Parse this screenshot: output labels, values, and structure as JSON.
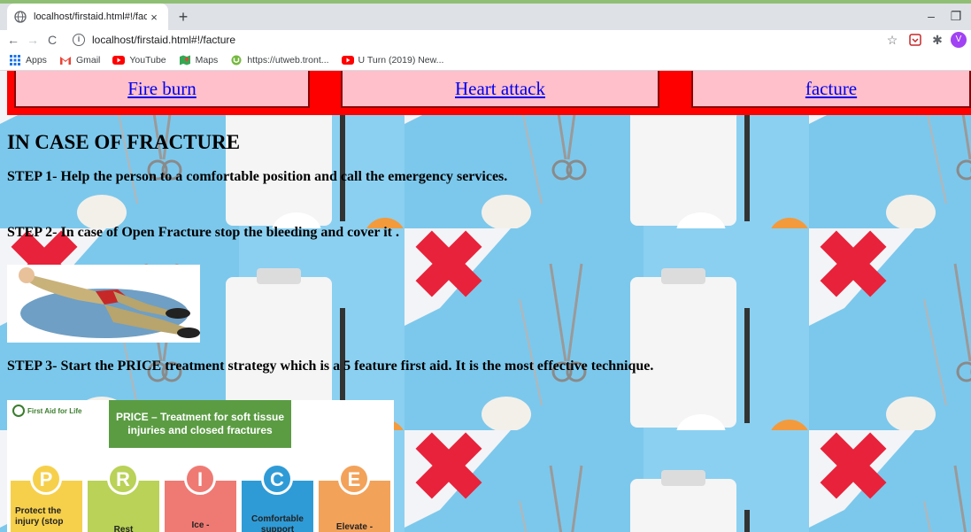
{
  "browser": {
    "tab_title": "localhost/firstaid.html#!/facture",
    "tab_close": "×",
    "new_tab": "+",
    "url": "localhost/firstaid.html#!/facture",
    "info_icon": "i",
    "minimize": "–",
    "restore": "❐",
    "star_icon": "☆",
    "extensions_icon": "✱",
    "profile_initial": "V",
    "nav": {
      "back": "←",
      "forward": "→",
      "reload": "C"
    }
  },
  "bookmarks": [
    {
      "label": "Apps",
      "icon": "apps-grid-icon",
      "color": "#1a73e8"
    },
    {
      "label": "Gmail",
      "icon": "gmail-icon",
      "color": "#ea4335"
    },
    {
      "label": "YouTube",
      "icon": "youtube-icon",
      "color": "#ff0000"
    },
    {
      "label": "Maps",
      "icon": "maps-icon",
      "color": "#34a853"
    },
    {
      "label": "https://utweb.tront...",
      "icon": "utorrent-icon",
      "color": "#76b83f"
    },
    {
      "label": "U Turn (2019) New...",
      "icon": "youtube-icon",
      "color": "#ff0000"
    }
  ],
  "nav_links": [
    {
      "label": "Fire burn"
    },
    {
      "label": "Heart attack"
    },
    {
      "label": "facture"
    }
  ],
  "content": {
    "title": "IN CASE OF FRACTURE",
    "step1": "STEP 1- Help the person to a comfortable position and call the emergency services.",
    "step2": "STEP 2- In case of Open Fracture stop the bleeding and cover it .",
    "step3": "STEP 3- Start the PRICE treatment strategy which is a 5 feature first aid. It is the most effective technique."
  },
  "price_image": {
    "brand": "First Aid for Life",
    "header": "PRICE – Treatment for soft tissue injuries and closed fractures",
    "columns": [
      {
        "letter": "P",
        "label": "Protect the injury (stop",
        "color": "#f7d04b"
      },
      {
        "letter": "R",
        "label": "Rest",
        "color": "#b9d257"
      },
      {
        "letter": "I",
        "label": "Ice -",
        "color": "#ef7a73"
      },
      {
        "letter": "C",
        "label": "Comfortable support",
        "color": "#2f9bd6"
      },
      {
        "letter": "E",
        "label": "Elevate -",
        "color": "#f3a25a"
      }
    ]
  },
  "colors": {
    "nav_bar": "#ff0000",
    "nav_box": "#ffc0cb",
    "link": "#0000ee",
    "background": "#7dc9ec"
  }
}
